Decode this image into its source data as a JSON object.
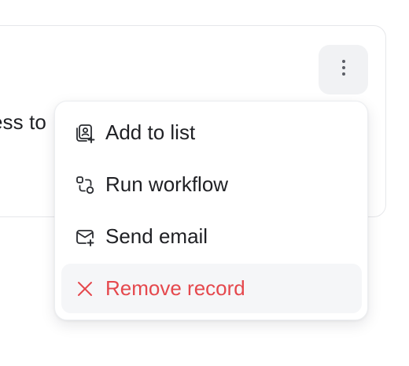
{
  "card": {
    "text": "ess to"
  },
  "more_button": {
    "icon": "vertical-ellipsis-icon"
  },
  "menu": {
    "items": [
      {
        "label": "Add to list",
        "icon": "add-to-list-icon",
        "danger": false
      },
      {
        "label": "Run workflow",
        "icon": "workflow-icon",
        "danger": false
      },
      {
        "label": "Send email",
        "icon": "send-email-icon",
        "danger": false
      },
      {
        "label": "Remove record",
        "icon": "close-icon",
        "danger": true
      }
    ]
  },
  "colors": {
    "danger": "#e5484d",
    "text": "#1f2024",
    "hover_bg": "#f5f6f8",
    "button_bg": "#f1f2f4"
  }
}
